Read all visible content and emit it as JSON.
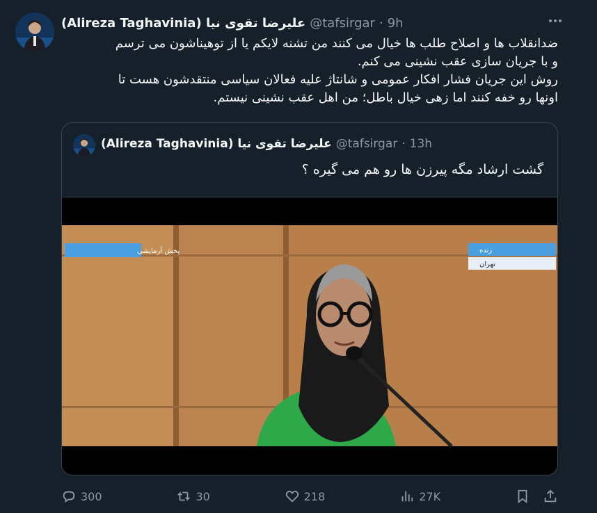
{
  "tweet": {
    "author_name": "(Alireza Taghavinia) علیرضا تقوی نیا",
    "handle": "@tafsirgar",
    "separator": "·",
    "time": "9h",
    "body": "ضدانقلاب ها و اصلاح طلب ها خیال می کنند من تشنه لایکم یا از توهیناشون می ترسم\nو با جریان سازی عقب نشینی می کنم.\nروش این جریان فشار افکار عمومی و شانتاژ علیه فعالان سیاسی منتقدشون هست تا\nاونها رو خفه کنند اما زهی خیال باطل؛ من اهل عقب نشینی نیستم."
  },
  "quoted_tweet": {
    "author_name": "(Alireza Taghavinia) علیرضا تقوی نیا",
    "handle": "@tafsirgar",
    "separator": "·",
    "time": "13h",
    "body": "گشت ارشاد مگه پیرزن ها رو هم می گیره ؟",
    "video": {
      "overlay_left": "پخش آزمایشی",
      "overlay_right_top": "زنده",
      "overlay_right_bottom": "تهران"
    }
  },
  "actions": {
    "replies": "300",
    "retweets": "30",
    "likes": "218",
    "views": "27K"
  },
  "colors": {
    "background": "#15202b",
    "secondary_text": "#8b98a5",
    "border": "#38444d",
    "overlay_blue": "#1d9bf0"
  },
  "icons": [
    "more-icon",
    "reply-icon",
    "retweet-icon",
    "like-icon",
    "views-icon",
    "bookmark-icon",
    "share-icon"
  ]
}
